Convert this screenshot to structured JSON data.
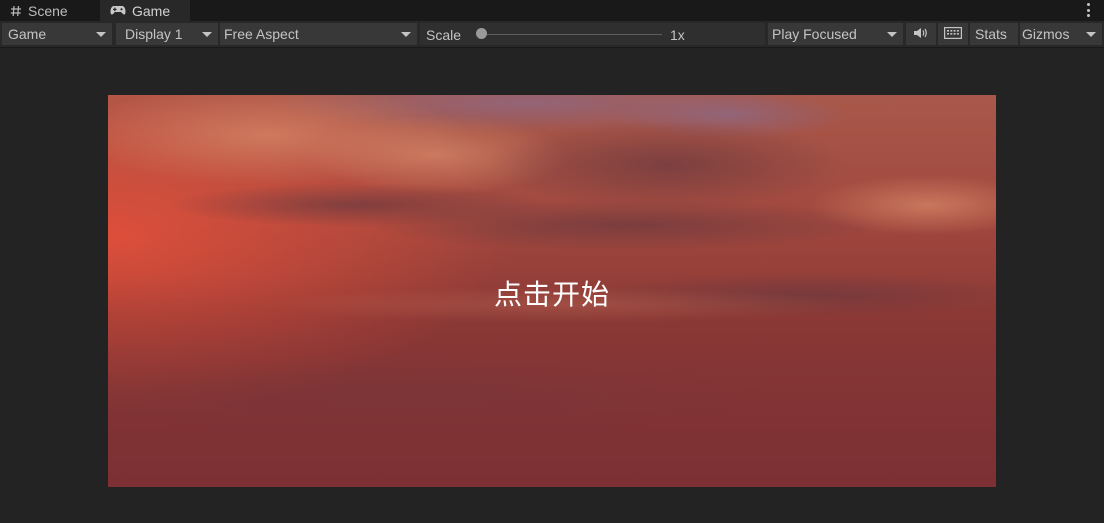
{
  "tabs": {
    "scene_label": "Scene",
    "game_label": "Game"
  },
  "toolbar": {
    "game_select": "Game",
    "display_select": "Display 1",
    "aspect_select": "Free Aspect",
    "scale_label": "Scale",
    "scale_value": "1x",
    "play_mode": "Play Focused",
    "stats_label": "Stats",
    "gizmos_label": "Gizmos"
  },
  "game_view": {
    "start_text": "点击开始"
  },
  "icons": {
    "scene": "hash-icon",
    "game": "gamepad-icon",
    "mute": "speaker-icon",
    "keyboard": "keyboard-icon",
    "more": "kebab-menu-icon"
  },
  "colors": {
    "editor_bg": "#232323",
    "toolbar_button": "#383838",
    "sky_top": "#a8584a",
    "sky_bottom": "#7e3133"
  }
}
